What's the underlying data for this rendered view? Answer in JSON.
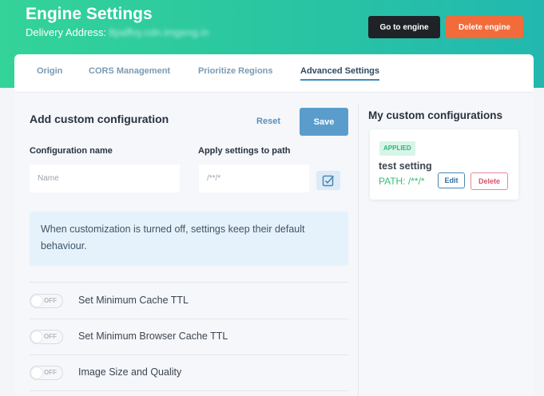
{
  "header": {
    "title": "Engine Settings",
    "delivery_label": "Delivery Address:",
    "delivery_value": "8paffvy.cdn.imgeng.in",
    "go_to_engine": "Go to engine",
    "delete_engine": "Delete engine"
  },
  "tabs": [
    {
      "label": "Origin",
      "active": false
    },
    {
      "label": "CORS Management",
      "active": false
    },
    {
      "label": "Prioritize Regions",
      "active": false
    },
    {
      "label": "Advanced Settings",
      "active": true
    }
  ],
  "custom_config": {
    "title": "Add custom configuration",
    "reset_label": "Reset",
    "save_label": "Save",
    "name_label": "Configuration name",
    "name_placeholder": "Name",
    "path_label": "Apply settings to path",
    "path_placeholder": "/**/*",
    "apply_icon": "checkbox-edit-icon",
    "info_text": "When customization is turned off, settings keep their default behaviour."
  },
  "settings": [
    {
      "label": "Set Minimum Cache TTL",
      "state": "OFF"
    },
    {
      "label": "Set Minimum Browser Cache TTL",
      "state": "OFF"
    },
    {
      "label": "Image Size and Quality",
      "state": "OFF"
    }
  ],
  "my_configs": {
    "title": "My custom configurations",
    "items": [
      {
        "status": "APPLIED",
        "name": "test setting",
        "path": "PATH: /**/*",
        "edit_label": "Edit",
        "delete_label": "Delete"
      }
    ]
  },
  "colors": {
    "brand_green": "#34d399",
    "brand_teal": "#22b8b0",
    "save_blue": "#5a9dcc",
    "delete_orange": "#f26b3a",
    "applied_green": "#2fb37c"
  }
}
